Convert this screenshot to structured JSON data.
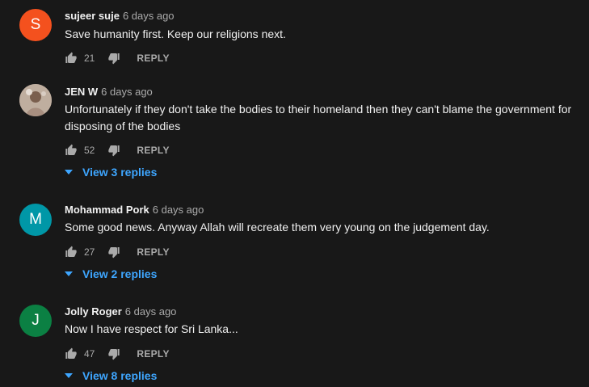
{
  "comments": [
    {
      "author": "sujeer suje",
      "time": "6 days ago",
      "avatar_letter": "S",
      "avatar_color": "#f4511e",
      "text": "Save humanity first. Keep our religions next.",
      "likes": "21",
      "reply_label": "REPLY"
    },
    {
      "author": "JEN W",
      "time": "6 days ago",
      "avatar_letter": "",
      "text": "Unfortunately if they don't take the bodies to their homeland then they can't blame the government for disposing of the bodies",
      "likes": "52",
      "reply_label": "REPLY",
      "view_replies": "View 3 replies"
    },
    {
      "author": "Mohammad Pork",
      "time": "6 days ago",
      "avatar_letter": "M",
      "avatar_color": "#0097a7",
      "text": "Some good news. Anyway Allah will recreate them very young on the judgement day.",
      "likes": "27",
      "reply_label": "REPLY",
      "view_replies": "View 2 replies"
    },
    {
      "author": "Jolly Roger",
      "time": "6 days ago",
      "avatar_letter": "J",
      "avatar_color": "#0b8043",
      "text": "Now I have respect for Sri Lanka...",
      "likes": "47",
      "reply_label": "REPLY",
      "view_replies": "View 8 replies"
    }
  ],
  "colors": {
    "background": "#181818",
    "text": "#f1f1f1",
    "secondary": "#aaaaaa",
    "link": "#3ea6ff"
  }
}
